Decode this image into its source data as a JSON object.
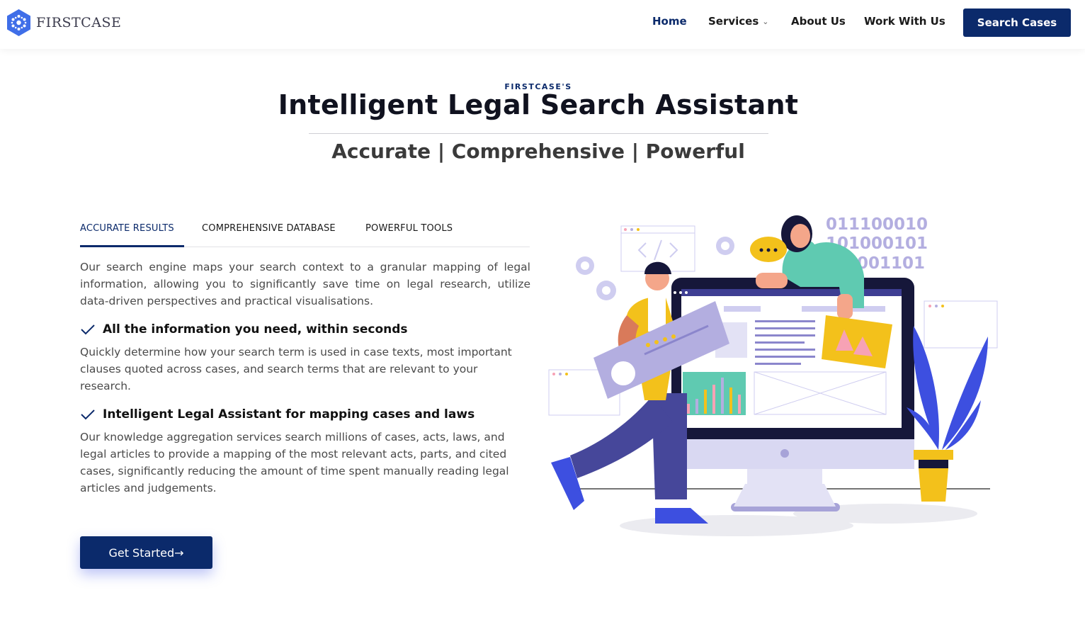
{
  "brand": {
    "name": "FIRSTCASE"
  },
  "nav": {
    "items": [
      {
        "label": "Home",
        "active": true
      },
      {
        "label": "Services",
        "dropdown": true
      },
      {
        "label": "About Us"
      },
      {
        "label": "Work With Us"
      }
    ],
    "cta": "Search Cases"
  },
  "hero": {
    "eyebrow": "FIRSTCASE'S",
    "title": "Intelligent Legal Search Assistant",
    "subtitle": "Accurate | Comprehensive | Powerful"
  },
  "tabs": [
    {
      "label": "ACCURATE RESULTS",
      "active": true
    },
    {
      "label": "COMPREHENSIVE DATABASE"
    },
    {
      "label": "POWERFUL TOOLS"
    }
  ],
  "content": {
    "intro": "Our search engine maps your search context to a granular mapping of legal information, allowing you to significantly save time on legal research, utilize data-driven perspectives and practical visualisations.",
    "features": [
      {
        "title": "All the information you need, within seconds",
        "text": "Quickly determine how your search term is used in case texts, most important clauses quoted across cases, and search terms that are relevant to your research."
      },
      {
        "title": "Intelligent Legal Assistant for mapping cases and laws",
        "text": "Our knowledge aggregation services search millions of cases, acts, laws, and legal articles to provide a mapping of the most relevant acts, parts, and cited cases, significantly reducing the amount of time spent manually reading legal articles and judgements."
      }
    ],
    "cta": "Get Started→"
  },
  "illustration": {
    "binary": [
      "011100010",
      "101000101",
      "001101"
    ]
  },
  "colors": {
    "primary": "#0b2a6b",
    "accent_purple": "#b3aee0",
    "plant_blue": "#3d4fe0"
  }
}
